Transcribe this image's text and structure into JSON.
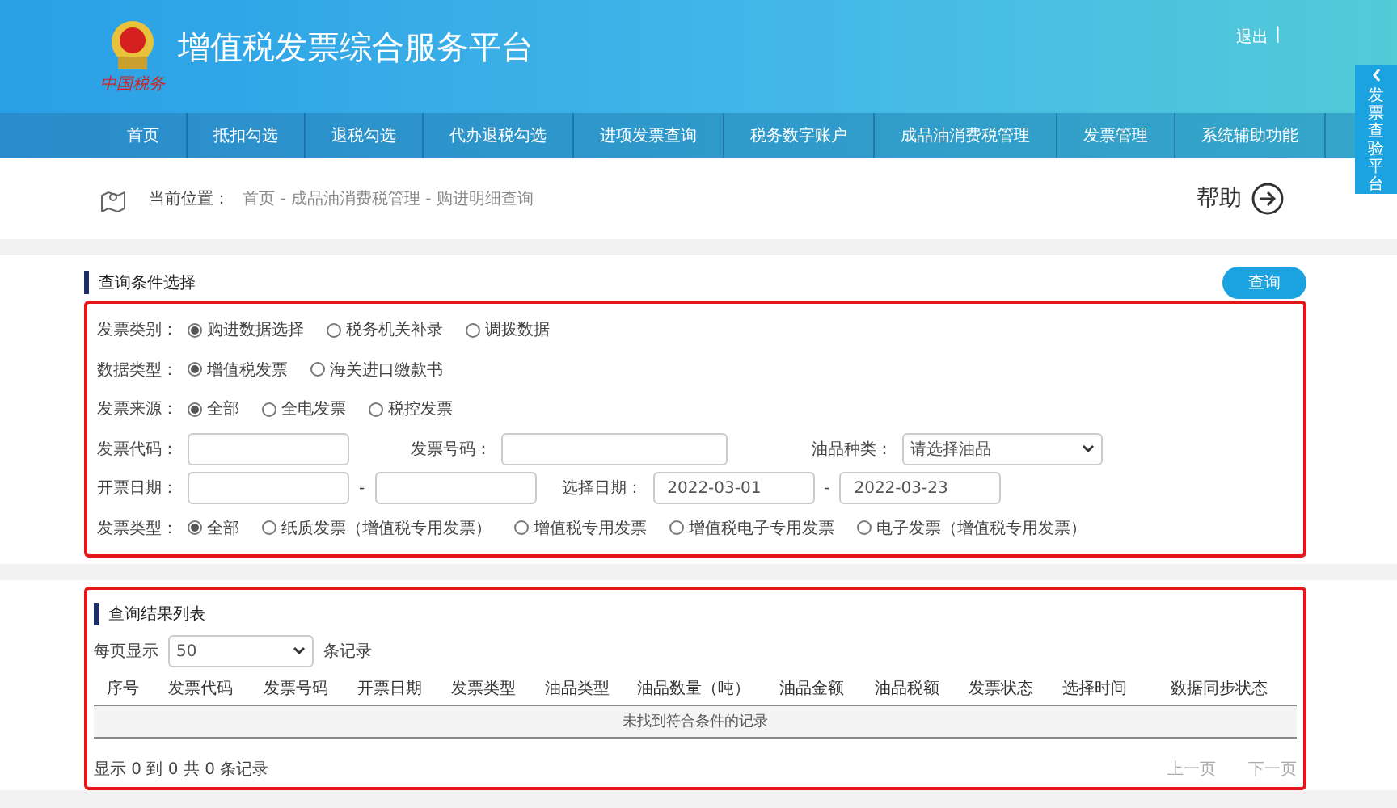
{
  "header": {
    "title": "增值税发票综合服务平台",
    "logo_caption": "中国税务",
    "logout": "退出",
    "separator": "|"
  },
  "nav": [
    {
      "label": "首页",
      "selected": false
    },
    {
      "label": "抵扣勾选",
      "selected": false
    },
    {
      "label": "退税勾选",
      "selected": false
    },
    {
      "label": "代办退税勾选",
      "selected": false
    },
    {
      "label": "进项发票查询",
      "selected": false
    },
    {
      "label": "税务数字账户",
      "selected": false
    },
    {
      "label": "成品油消费税管理",
      "selected": false
    },
    {
      "label": "发票管理",
      "selected": false
    },
    {
      "label": "系统辅助功能",
      "selected": false
    }
  ],
  "side_tab": {
    "label": "发票查验平台"
  },
  "breadcrumb": {
    "prefix": "当前位置：",
    "path": "首页 - 成品油消费税管理 - 购进明细查询",
    "help": "帮助"
  },
  "query": {
    "title": "查询条件选择",
    "button": "查询",
    "rows": [
      {
        "kind": "radio",
        "label": "发票类别：",
        "options": [
          {
            "label": "购进数据选择",
            "selected": true
          },
          {
            "label": "税务机关补录",
            "selected": false
          },
          {
            "label": "调拨数据",
            "selected": false
          }
        ]
      },
      {
        "kind": "radio",
        "label": "数据类型：",
        "options": [
          {
            "label": "增值税发票",
            "selected": true
          },
          {
            "label": "海关进口缴款书",
            "selected": false
          }
        ]
      },
      {
        "kind": "radio",
        "label": "发票来源：",
        "options": [
          {
            "label": "全部",
            "selected": true
          },
          {
            "label": "全电发票",
            "selected": false
          },
          {
            "label": "税控发票",
            "selected": false
          }
        ]
      },
      {
        "kind": "fields",
        "groups": [
          {
            "label": "发票代码：",
            "kind": "input"
          },
          {
            "label": "发票号码：",
            "kind": "input"
          },
          {
            "label": "油品种类：",
            "kind": "select",
            "value": "请选择油品"
          }
        ]
      },
      {
        "kind": "ranges",
        "groups": [
          {
            "label": "开票日期：",
            "dash": "-"
          },
          {
            "label": "选择日期：",
            "from": "2022-03-01",
            "to": "2022-03-23",
            "dash": "-"
          }
        ]
      },
      {
        "kind": "radio",
        "label": "发票类型：",
        "options": [
          {
            "label": "全部",
            "selected": true
          },
          {
            "label": "纸质发票（增值税专用发票）",
            "selected": false
          },
          {
            "label": "增值税专用发票",
            "selected": false
          },
          {
            "label": "增值税电子专用发票",
            "selected": false
          },
          {
            "label": "电子发票（增值税专用发票）",
            "selected": false
          }
        ]
      }
    ]
  },
  "results": {
    "title": "查询结果列表",
    "page_size_prefix": "每页显示",
    "page_size": "50",
    "page_size_suffix": "条记录",
    "columns": [
      "序号",
      "发票代码",
      "发票号码",
      "开票日期",
      "发票类型",
      "油品类型",
      "油品数量（吨）",
      "油品金额",
      "油品税额",
      "发票状态",
      "选择时间",
      "数据同步状态"
    ],
    "empty": "未找到符合条件的记录",
    "summary": "显示 0 到 0 共 0 条记录",
    "prev": "上一页",
    "next": "下一页"
  }
}
